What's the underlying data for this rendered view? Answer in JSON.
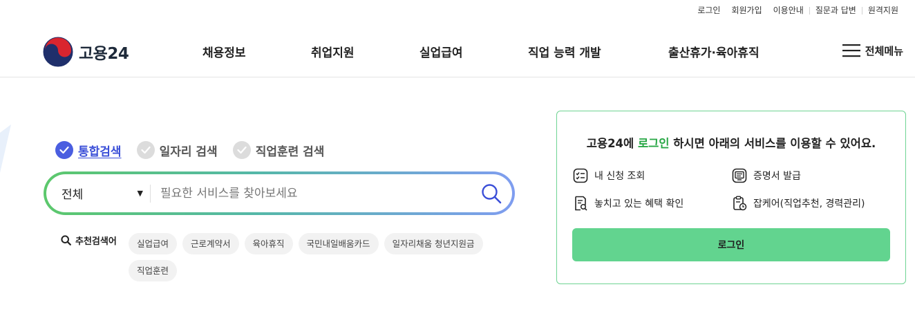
{
  "utility": [
    "로그인",
    "회원가입",
    "이용안내",
    "질문과 답변",
    "원격지원"
  ],
  "logo": {
    "text": "고용24",
    "icon": "taegeuk-logo-icon"
  },
  "gnb": [
    "채용정보",
    "취업지원",
    "실업급여",
    "직업 능력 개발",
    "출산휴가·육아휴직"
  ],
  "allmenu": {
    "label": "전체메뉴",
    "icon": "hamburger-icon"
  },
  "search": {
    "tabs": [
      {
        "label": "통합검색",
        "active": true
      },
      {
        "label": "일자리 검색",
        "active": false
      },
      {
        "label": "직업훈련 검색",
        "active": false
      }
    ],
    "select_value": "전체",
    "placeholder": "필요한 서비스를 찾아보세요",
    "search_icon": "search-icon"
  },
  "recommend": {
    "label": "추천검색어",
    "keywords": [
      "실업급여",
      "근로계약서",
      "육아휴직",
      "국민내일배움카드",
      "일자리채움 청년지원금",
      "직업훈련"
    ]
  },
  "login_box": {
    "title_pre": "고용24에 ",
    "title_highlight": "로그인",
    "title_post": " 하시면 아래의 서비스를 이용할 수 있어요.",
    "services": [
      {
        "label": "내 신청 조회",
        "icon": "checklist-icon"
      },
      {
        "label": "증명서 발급",
        "icon": "certificate-icon"
      },
      {
        "label": "놓치고 있는 혜택 확인",
        "icon": "document-search-icon"
      },
      {
        "label": "잡케어(직업추천, 경력관리)",
        "icon": "clipboard-clock-icon"
      }
    ],
    "button": "로그인"
  },
  "colors": {
    "accent": "#4a5ee0",
    "green": "#62d48f",
    "highlight": "#28a745"
  }
}
